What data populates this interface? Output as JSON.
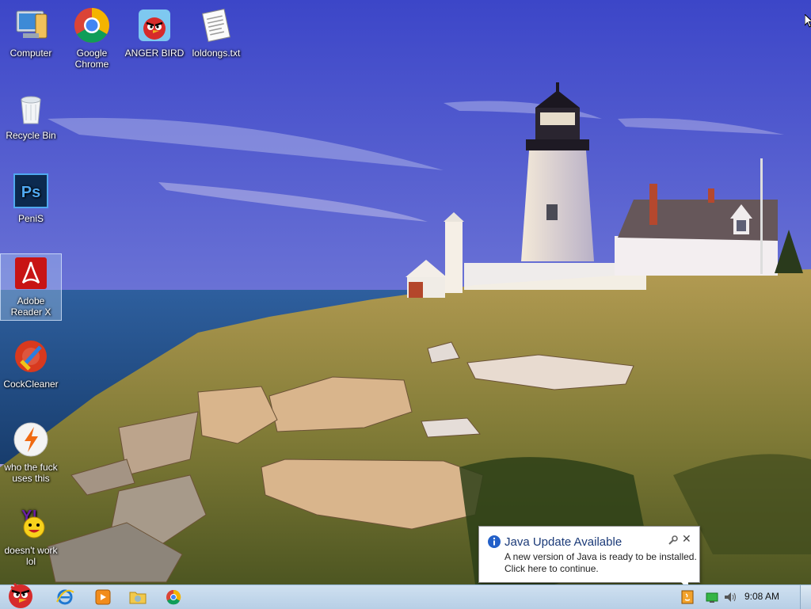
{
  "desktop": {
    "icons": [
      {
        "label": "Computer",
        "icon": "computer-icon"
      },
      {
        "label": "Google Chrome",
        "icon": "chrome-icon"
      },
      {
        "label": "ANGER BIRD",
        "icon": "angry-bird-icon"
      },
      {
        "label": "loldongs.txt",
        "icon": "text-file-icon"
      },
      {
        "label": "Recycle Bin",
        "icon": "recycle-bin-icon"
      },
      {
        "label": "PeniS",
        "icon": "photoshop-icon"
      },
      {
        "label": "Adobe Reader X",
        "icon": "adobe-reader-icon"
      },
      {
        "label": "CockCleaner",
        "icon": "ccleaner-icon"
      },
      {
        "label": "who the fuck uses this",
        "icon": "winamp-icon"
      },
      {
        "label": "doesn't work lol",
        "icon": "yahoo-messenger-icon"
      }
    ]
  },
  "notification": {
    "title": "Java Update Available",
    "line1": "A new version of Java is ready to be installed.",
    "line2": "Click here to continue."
  },
  "taskbar": {
    "time": "9:08 AM",
    "pinned": [
      "angry-bird-start-icon",
      "internet-explorer-icon",
      "media-player-icon",
      "folder-icon",
      "chrome-icon"
    ],
    "tray": [
      "java-tray-icon",
      "network-icon",
      "volume-icon"
    ]
  },
  "colors": {
    "sky_top": "#3b49c9",
    "sky_bottom": "#c4b4d8",
    "sea": "#1f4f8a",
    "grass": "#8a8a3a",
    "taskbar": "#c3d7ea"
  }
}
